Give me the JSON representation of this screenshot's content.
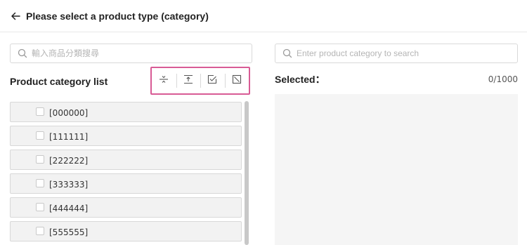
{
  "header": {
    "title": "Please select a product type (category)"
  },
  "left_panel": {
    "search_placeholder": "輸入商品分類搜尋",
    "list_title": "Product category list",
    "toolbar": [
      {
        "icon": "expand-all-icon",
        "name": "expand-all-button"
      },
      {
        "icon": "collapse-all-icon",
        "name": "collapse-all-button"
      },
      {
        "icon": "select-all-icon",
        "name": "select-all-button"
      },
      {
        "icon": "deselect-all-icon",
        "name": "deselect-all-button"
      }
    ],
    "categories": [
      {
        "label": "[000000]",
        "checked": false
      },
      {
        "label": "[111111]",
        "checked": false
      },
      {
        "label": "[222222]",
        "checked": false
      },
      {
        "label": "[333333]",
        "checked": false
      },
      {
        "label": "[444444]",
        "checked": false
      },
      {
        "label": "[555555]",
        "checked": false
      }
    ]
  },
  "right_panel": {
    "search_placeholder": "Enter product category to search",
    "selected_label": "Selected：",
    "selected_count": "0/1000"
  },
  "colors": {
    "highlight_border": "#d85b95"
  }
}
